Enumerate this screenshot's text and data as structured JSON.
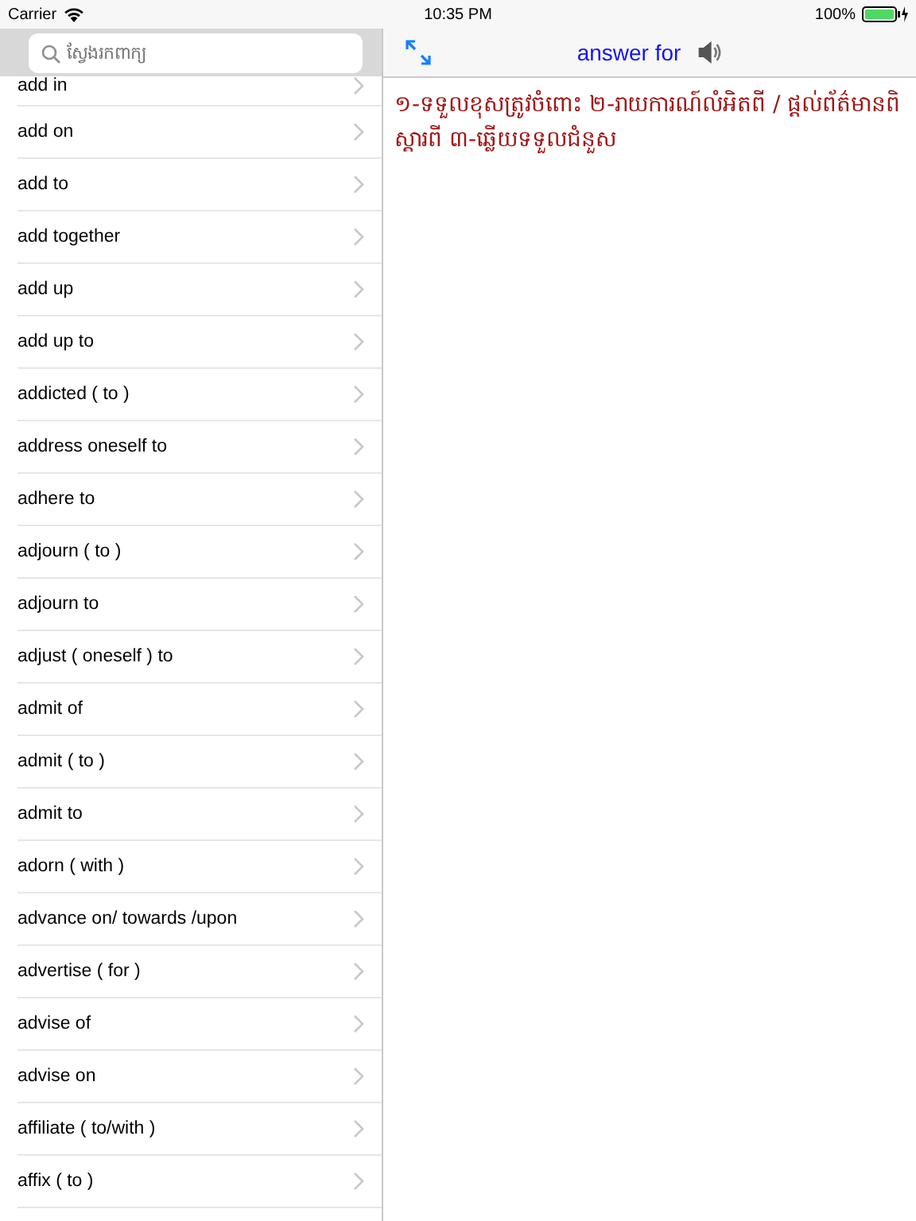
{
  "status_bar": {
    "carrier": "Carrier",
    "time": "10:35 PM",
    "battery": "100%"
  },
  "sidebar": {
    "search": {
      "placeholder": "ស្វែងរកពាក្យ"
    },
    "items": [
      {
        "label": "add in"
      },
      {
        "label": "add on"
      },
      {
        "label": "add to"
      },
      {
        "label": "add together"
      },
      {
        "label": "add up"
      },
      {
        "label": "add up to"
      },
      {
        "label": "addicted ( to )"
      },
      {
        "label": "address oneself to"
      },
      {
        "label": "adhere to"
      },
      {
        "label": "adjourn ( to )"
      },
      {
        "label": "adjourn to"
      },
      {
        "label": "adjust ( oneself ) to"
      },
      {
        "label": "admit of"
      },
      {
        "label": "admit ( to )"
      },
      {
        "label": "admit to"
      },
      {
        "label": "adorn ( with )"
      },
      {
        "label": "advance on/ towards /upon"
      },
      {
        "label": "advertise ( for )"
      },
      {
        "label": "advise of"
      },
      {
        "label": "advise on"
      },
      {
        "label": "affiliate ( to/with )"
      },
      {
        "label": "affix ( to )"
      }
    ]
  },
  "detail": {
    "title": "answer for",
    "definition": "១-ទទួលខុសត្រូវចំពោះ ២-រាយការណ៍លំអិតពី / ផ្តល់ព័ត៌មានពិស្តារពី ៣-ឆ្លើយទទួលជំនួស"
  }
}
